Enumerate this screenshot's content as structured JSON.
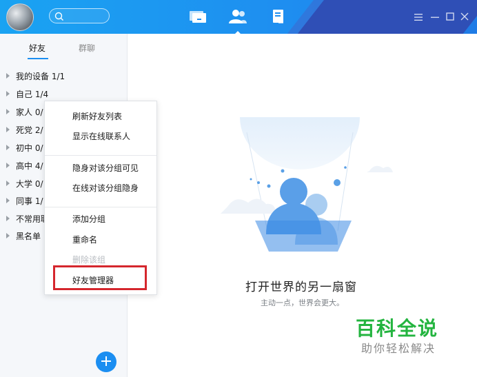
{
  "header": {
    "search": {
      "placeholder": ""
    },
    "nav": [
      "message-tab-icon",
      "contacts-tab-icon",
      "apps-tab-icon"
    ],
    "window_controls": [
      "menu-icon",
      "minimize-icon",
      "maximize-icon",
      "close-icon"
    ]
  },
  "sidebar": {
    "tabs": [
      "好友",
      "群聊"
    ],
    "active_tab": "好友",
    "groups": [
      {
        "label": "我的设备 1/1"
      },
      {
        "label": "自己 1/4"
      },
      {
        "label": "家人 0/"
      },
      {
        "label": "死党 2/"
      },
      {
        "label": "初中 0/"
      },
      {
        "label": "高中 4/"
      },
      {
        "label": "大学 0/"
      },
      {
        "label": "同事 1/"
      },
      {
        "label": "不常用联"
      },
      {
        "label": "黑名单"
      }
    ]
  },
  "context_menu": {
    "items": [
      {
        "label": "刷新好友列表"
      },
      {
        "label": "显示在线联系人"
      },
      {
        "label": "隐身对该分组可见"
      },
      {
        "label": "在线对该分组隐身"
      },
      {
        "label": "添加分组"
      },
      {
        "label": "重命名"
      },
      {
        "label": "删除该组",
        "disabled": true
      },
      {
        "label": "好友管理器",
        "highlighted": true
      }
    ],
    "highlight_color": "#d5262d"
  },
  "main": {
    "title": "打开世界的另一扇窗",
    "subtitle": "主动一点，世界会更大。"
  },
  "watermark": {
    "line1": "百科全说",
    "line2": "助你轻松解决"
  },
  "colors": {
    "accent": "#1b8ef1",
    "header_dark": "#2f4fb6",
    "watermark_green": "#23b43f"
  }
}
